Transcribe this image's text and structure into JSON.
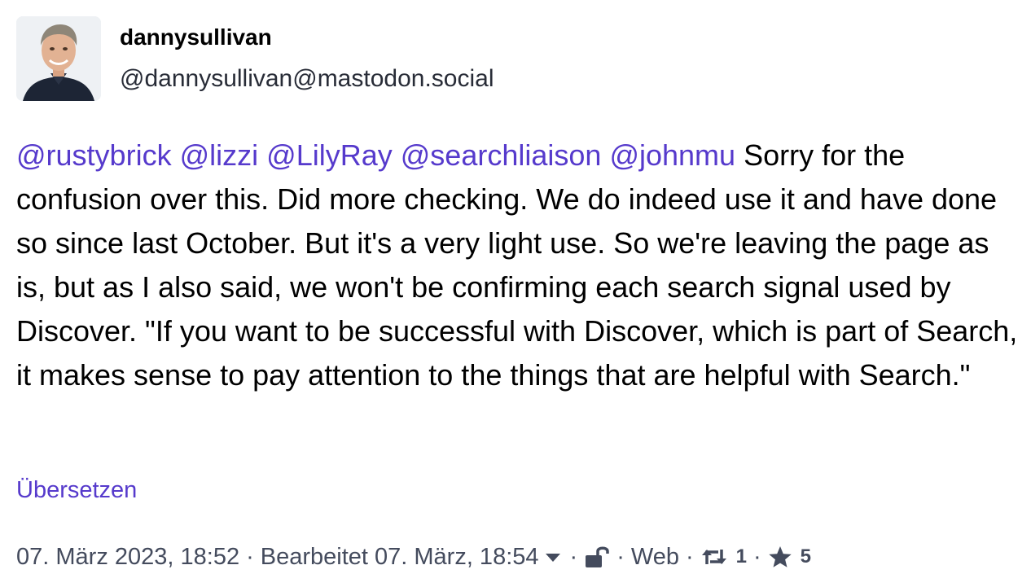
{
  "author": {
    "display_name": "dannysullivan",
    "account": "@dannysullivan@mastodon.social"
  },
  "post": {
    "mentions": [
      "@rustybrick",
      "@lizzi",
      "@LilyRay",
      "@searchliaison",
      "@johnmu"
    ],
    "body": " Sorry for the confusion over this. Did more checking. We do indeed use it and have done so since last October. But it's a very light use. So we're leaving the page as is, but as I also said, we won't be confirming each search signal used by Discover. \"If you want to be successful with Discover, which is part of Search, it makes sense to pay attention to the things that are helpful with Search.\""
  },
  "translate_label": "Übersetzen",
  "meta": {
    "date": "07. März 2023, 18:52",
    "edited": "Bearbeitet 07. März, 18:54",
    "separator": "·",
    "application": "Web",
    "reblogs": "1",
    "favourites": "5"
  },
  "icons": {
    "edit_history": "chevron-down-icon",
    "visibility": "unlock-icon",
    "reblog": "retweet-icon",
    "favourite": "star-icon"
  },
  "colors": {
    "link": "#563acc",
    "meta_text": "#444b5d"
  }
}
